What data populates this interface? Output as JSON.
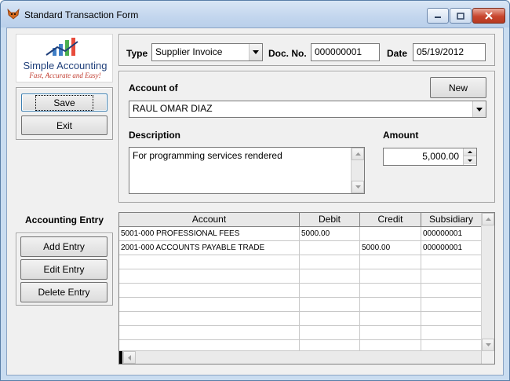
{
  "window": {
    "title": "Standard Transaction Form"
  },
  "logo": {
    "title": "Simple Accounting",
    "tagline": "Fast, Accurate and Easy!"
  },
  "actions": {
    "save_label": "Save",
    "exit_label": "Exit"
  },
  "header": {
    "type_label": "Type",
    "type_value": "Supplier Invoice",
    "docno_label": "Doc. No.",
    "docno_value": "000000001",
    "date_label": "Date",
    "date_value": "05/19/2012"
  },
  "details": {
    "account_of_label": "Account of",
    "new_label": "New",
    "account_value": "RAUL OMAR DIAZ",
    "description_label": "Description",
    "description_value": "For programming services rendered",
    "amount_label": "Amount",
    "amount_value": "5,000.00"
  },
  "entry": {
    "section_label": "Accounting Entry",
    "add_label": "Add Entry",
    "edit_label": "Edit Entry",
    "delete_label": "Delete Entry"
  },
  "grid": {
    "columns": [
      "Account",
      "Debit",
      "Credit",
      "Subsidiary"
    ],
    "rows": [
      {
        "account": "5001-000 PROFESSIONAL FEES",
        "debit": "5000.00",
        "credit": "",
        "subsidiary": "000000001"
      },
      {
        "account": "2001-000 ACCOUNTS PAYABLE TRADE",
        "debit": "",
        "credit": "5000.00",
        "subsidiary": "000000001"
      }
    ]
  }
}
